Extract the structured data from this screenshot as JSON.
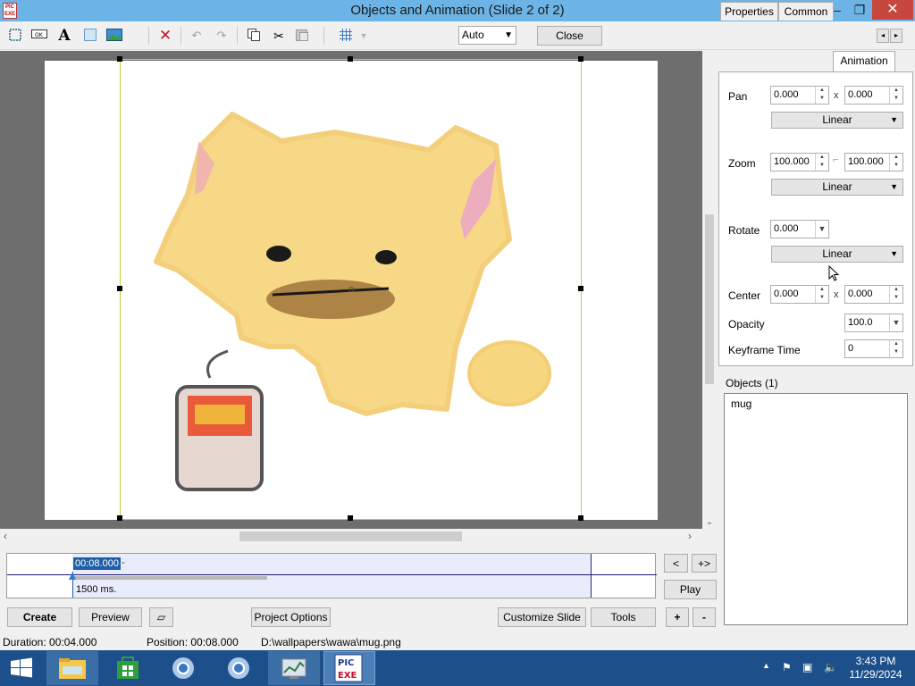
{
  "window": {
    "title": "Objects and Animation  (Slide 2 of 2)",
    "app_icon_text": "PIC EXE",
    "controls": {
      "minimize": "–",
      "maximize": "❐",
      "close": "✕"
    }
  },
  "toolbar": {
    "icons": [
      "frame-icon",
      "ok-button-icon",
      "text-icon",
      "rectangle-icon",
      "image-icon",
      "delete-icon",
      "undo-icon",
      "redo-icon",
      "copy-icon",
      "cut-icon",
      "paste-icon",
      "grid-icon"
    ],
    "zoom_select": "Auto",
    "close_label": "Close",
    "nav_prev": "◂",
    "nav_next": "▸"
  },
  "timeline": {
    "position_label": "00:08.000",
    "position_dash": "-",
    "duration_label": "1500 ms.",
    "progress_fraction": 0.375
  },
  "timeline_buttons": {
    "prev": "<",
    "next": "+>",
    "play": "Play"
  },
  "bottom_buttons": {
    "create": "Create",
    "preview": "Preview",
    "project_options": "Project Options",
    "customize_slide": "Customize Slide",
    "tools": "Tools",
    "plus": "+",
    "minus": "-"
  },
  "tabs": [
    {
      "label": "Properties",
      "active": false
    },
    {
      "label": "Common",
      "active": false
    },
    {
      "label": "Animation",
      "active": true
    }
  ],
  "animation": {
    "pan_label": "Pan",
    "pan_x": "0.000",
    "pan_y": "0.000",
    "pan_interp": "Linear",
    "zoom_label": "Zoom",
    "zoom_x": "100.000",
    "zoom_y": "100.000",
    "zoom_interp": "Linear",
    "rotate_label": "Rotate",
    "rotate_value": "0.000",
    "rotate_interp": "Linear",
    "center_label": "Center",
    "center_x": "0.000",
    "center_y": "0.000",
    "opacity_label": "Opacity",
    "opacity_value": "100.0",
    "keyframe_label": "Keyframe Time",
    "keyframe_value": "0",
    "x_sep": "x"
  },
  "objects": {
    "label": "Objects (1)",
    "items": [
      "mug"
    ]
  },
  "status": {
    "duration": "Duration:  00:04.000",
    "position": "Position:  00:08.000",
    "path": "D:\\wallpapers\\wawa\\mug.png"
  },
  "taskbar": {
    "clock_time": "3:43 PM",
    "clock_date": "11/29/2024"
  },
  "colors": {
    "title_bar": "#6cb4e6",
    "taskbar": "#1d4f8a",
    "selection_border": "#b7d431",
    "timeline_highlight": "#1e5fa8"
  }
}
